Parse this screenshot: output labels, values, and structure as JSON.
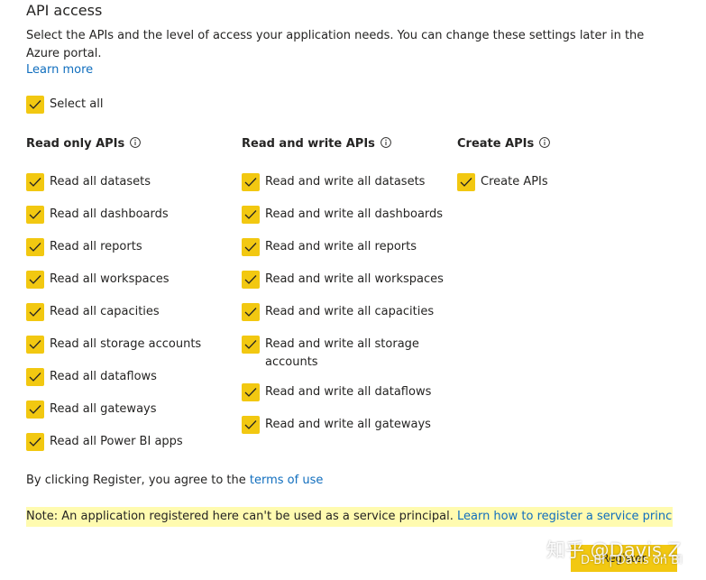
{
  "header": {
    "title": "API access",
    "description": "Select the APIs and the level of access your application needs. You can change these settings later in the Azure portal.",
    "learn_more": "Learn more"
  },
  "select_all": {
    "label": "Select all",
    "checked": true
  },
  "columns": [
    {
      "header": "Read only APIs",
      "items": [
        "Read all datasets",
        "Read all dashboards",
        "Read all reports",
        "Read all workspaces",
        "Read all capacities",
        "Read all storage accounts",
        "Read all dataflows",
        "Read all gateways",
        "Read all Power BI apps"
      ]
    },
    {
      "header": "Read and write APIs",
      "items": [
        "Read and write all datasets",
        "Read and write all dashboards",
        "Read and write all reports",
        "Read and write all workspaces",
        "Read and write all capacities",
        "Read and write all storage accounts",
        "Read and write all dataflows",
        "Read and write all gateways"
      ]
    },
    {
      "header": "Create APIs",
      "items": [
        "Create APIs"
      ]
    }
  ],
  "agreement": {
    "text": "By clicking Register, you agree to the",
    "link": "terms of use"
  },
  "note": {
    "text": "Note: An application registered here can't be used as a service principal.",
    "link": "Learn how to register a service principal"
  },
  "register_button": "Register",
  "watermark": {
    "line1": "知乎 @Davis.Z",
    "line2": "D-BI | Davis on BI"
  },
  "colors": {
    "accent": "#f2c811",
    "link": "#106ebe",
    "note_background": "#fffbb0",
    "text": "#252423"
  }
}
